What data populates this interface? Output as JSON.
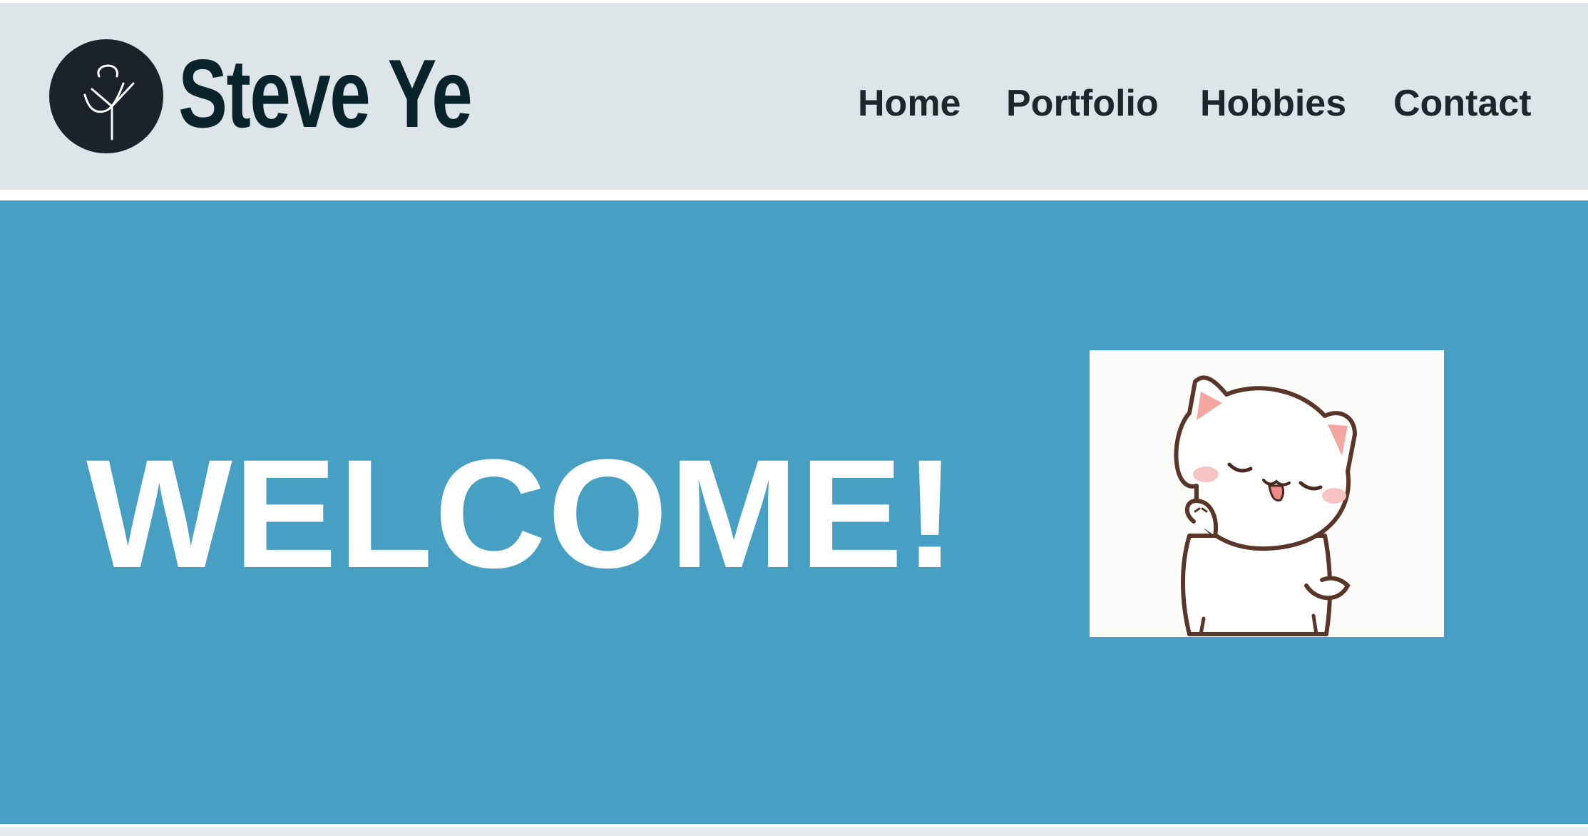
{
  "brand": {
    "logo_icon": "sy-monogram-logo-icon",
    "name": "Steve Ye"
  },
  "nav": {
    "home": "Home",
    "portfolio": "Portfolio",
    "hobbies": "Hobbies",
    "contact": "Contact"
  },
  "hero": {
    "heading": "WELCOME!",
    "image_icon": "waving-cat-image"
  },
  "colors": {
    "header_bg": "#dde5e8",
    "hero_bg": "#47a0c3",
    "brand_text": "#08232a",
    "nav_text": "#1e252c",
    "logo_bg": "#1c222b"
  }
}
